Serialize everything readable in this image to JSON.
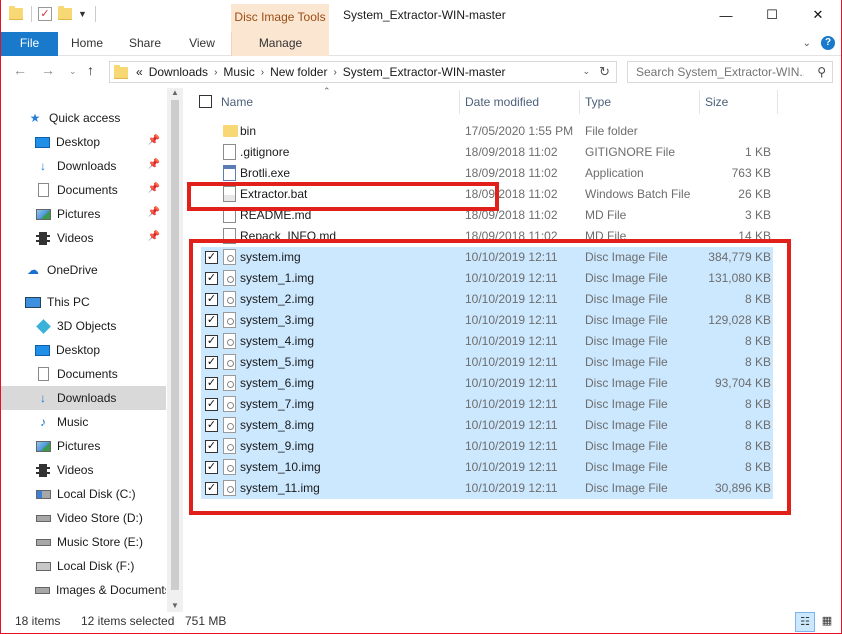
{
  "window": {
    "title": "System_Extractor-WIN-master",
    "context_tab": "Disc Image Tools",
    "controls": [
      "—",
      "☐",
      "✕"
    ]
  },
  "ribbon": {
    "tabs": [
      "File",
      "Home",
      "Share",
      "View",
      "Manage"
    ],
    "help": "?"
  },
  "address": {
    "prefix": "«",
    "crumbs": [
      "Downloads",
      "Music",
      "New folder",
      "System_Extractor-WIN-master"
    ],
    "search_placeholder": "Search System_Extractor-WIN..."
  },
  "nav": {
    "items": [
      {
        "label": "Quick access",
        "icon": "star-icon",
        "pinned": false
      },
      {
        "label": "Desktop",
        "icon": "desktop-icon",
        "pinned": true
      },
      {
        "label": "Downloads",
        "icon": "download-icon",
        "pinned": true
      },
      {
        "label": "Documents",
        "icon": "documents-icon",
        "pinned": true
      },
      {
        "label": "Pictures",
        "icon": "pictures-icon",
        "pinned": true
      },
      {
        "label": "Videos",
        "icon": "videos-icon",
        "pinned": true
      },
      {
        "label": "OneDrive",
        "icon": "cloud-icon",
        "pinned": false
      },
      {
        "label": "This PC",
        "icon": "pc-icon",
        "pinned": false
      },
      {
        "label": "3D Objects",
        "icon": "3d-objects-icon",
        "pinned": false
      },
      {
        "label": "Desktop",
        "icon": "desktop-icon",
        "pinned": false
      },
      {
        "label": "Documents",
        "icon": "documents-icon",
        "pinned": false
      },
      {
        "label": "Downloads",
        "icon": "download-icon",
        "pinned": false,
        "selected": true
      },
      {
        "label": "Music",
        "icon": "music-icon",
        "pinned": false
      },
      {
        "label": "Pictures",
        "icon": "pictures-icon",
        "pinned": false
      },
      {
        "label": "Videos",
        "icon": "videos-icon",
        "pinned": false
      },
      {
        "label": "Local Disk (C:)",
        "icon": "drive-c-icon",
        "pinned": false
      },
      {
        "label": "Video Store (D:)",
        "icon": "drive-icon",
        "pinned": false
      },
      {
        "label": "Music Store (E:)",
        "icon": "drive-icon",
        "pinned": false
      },
      {
        "label": "Local Disk (F:)",
        "icon": "drive-f-icon",
        "pinned": false
      },
      {
        "label": "Images & Documents (G:)",
        "icon": "drive-icon",
        "pinned": false
      }
    ]
  },
  "columns": {
    "name": "Name",
    "date": "Date modified",
    "type": "Type",
    "size": "Size"
  },
  "files": [
    {
      "name": "bin",
      "date": "17/05/2020 1:55 PM",
      "type": "File folder",
      "size": "",
      "icon": "folder",
      "selected": false
    },
    {
      "name": ".gitignore",
      "date": "18/09/2018 11:02",
      "type": "GITIGNORE File",
      "size": "1 KB",
      "icon": "file",
      "selected": false
    },
    {
      "name": "Brotli.exe",
      "date": "18/09/2018 11:02",
      "type": "Application",
      "size": "763 KB",
      "icon": "exe",
      "selected": false
    },
    {
      "name": "Extractor.bat",
      "date": "18/09/2018 11:02",
      "type": "Windows Batch File",
      "size": "26 KB",
      "icon": "bat",
      "selected": false
    },
    {
      "name": "README.md",
      "date": "18/09/2018 11:02",
      "type": "MD File",
      "size": "3 KB",
      "icon": "file",
      "selected": false
    },
    {
      "name": "Repack_INFO.md",
      "date": "18/09/2018 11:02",
      "type": "MD File",
      "size": "14 KB",
      "icon": "file",
      "selected": false
    },
    {
      "name": "system.img",
      "date": "10/10/2019 12:11",
      "type": "Disc Image File",
      "size": "384,779 KB",
      "icon": "img",
      "selected": true
    },
    {
      "name": "system_1.img",
      "date": "10/10/2019 12:11",
      "type": "Disc Image File",
      "size": "131,080 KB",
      "icon": "img",
      "selected": true
    },
    {
      "name": "system_2.img",
      "date": "10/10/2019 12:11",
      "type": "Disc Image File",
      "size": "8 KB",
      "icon": "img",
      "selected": true
    },
    {
      "name": "system_3.img",
      "date": "10/10/2019 12:11",
      "type": "Disc Image File",
      "size": "129,028 KB",
      "icon": "img",
      "selected": true
    },
    {
      "name": "system_4.img",
      "date": "10/10/2019 12:11",
      "type": "Disc Image File",
      "size": "8 KB",
      "icon": "img",
      "selected": true
    },
    {
      "name": "system_5.img",
      "date": "10/10/2019 12:11",
      "type": "Disc Image File",
      "size": "8 KB",
      "icon": "img",
      "selected": true
    },
    {
      "name": "system_6.img",
      "date": "10/10/2019 12:11",
      "type": "Disc Image File",
      "size": "93,704 KB",
      "icon": "img",
      "selected": true
    },
    {
      "name": "system_7.img",
      "date": "10/10/2019 12:11",
      "type": "Disc Image File",
      "size": "8 KB",
      "icon": "img",
      "selected": true
    },
    {
      "name": "system_8.img",
      "date": "10/10/2019 12:11",
      "type": "Disc Image File",
      "size": "8 KB",
      "icon": "img",
      "selected": true
    },
    {
      "name": "system_9.img",
      "date": "10/10/2019 12:11",
      "type": "Disc Image File",
      "size": "8 KB",
      "icon": "img",
      "selected": true
    },
    {
      "name": "system_10.img",
      "date": "10/10/2019 12:11",
      "type": "Disc Image File",
      "size": "8 KB",
      "icon": "img",
      "selected": true
    },
    {
      "name": "system_11.img",
      "date": "10/10/2019 12:11",
      "type": "Disc Image File",
      "size": "30,896 KB",
      "icon": "img",
      "selected": true
    }
  ],
  "status": {
    "item_count": "18 items",
    "selection": "12 items selected",
    "selection_size": "751 MB"
  },
  "colors": {
    "accent": "#1979ca",
    "selection": "#cce8ff",
    "highlight_box": "#e1201a",
    "context_tab": "#fbe6d2"
  }
}
